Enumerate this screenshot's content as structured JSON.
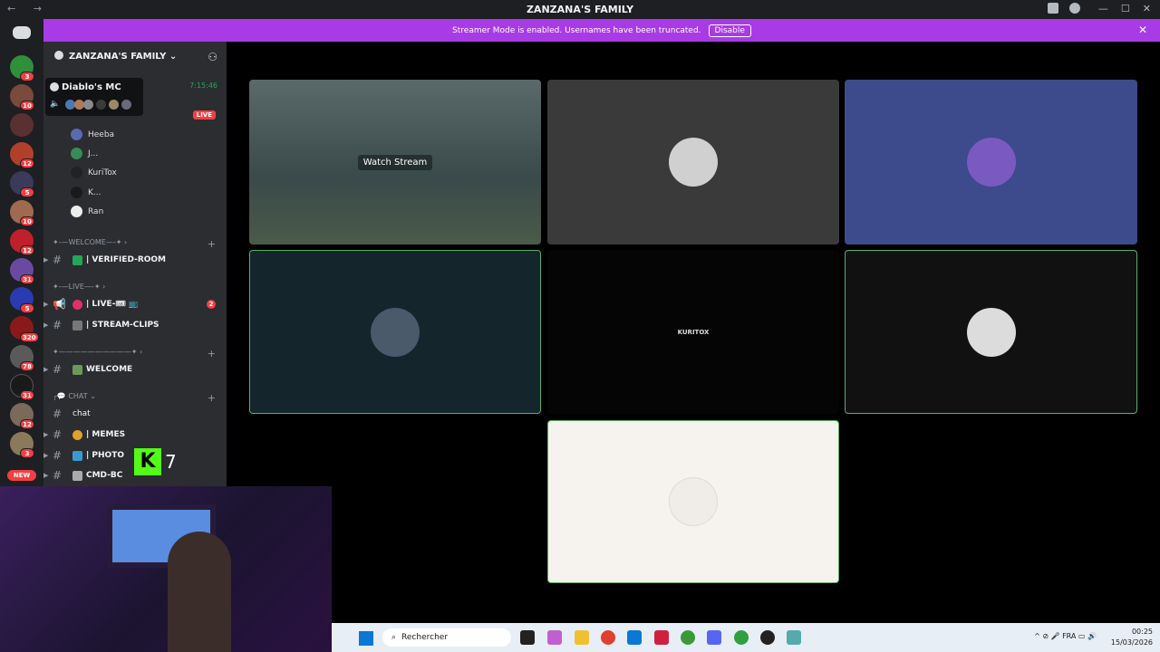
{
  "window": {
    "title": "ZANZANA'S FAMILY"
  },
  "banner": {
    "message": "Streamer Mode is enabled. Usernames have been truncated.",
    "button": "Disable"
  },
  "rail": {
    "badges": [
      "3",
      "10",
      "12",
      "5",
      "10",
      "12",
      "31",
      "5",
      "320",
      "78",
      "31",
      "12",
      "3"
    ],
    "new_label": "NEW"
  },
  "server": {
    "name": "ZANZANA'S FAMILY"
  },
  "voice": {
    "channel_name": "Diablo's MC",
    "elapsed": "7:15:46",
    "live_label": "LIVE",
    "users": [
      "Heeba",
      "J...",
      "KuriTox",
      "K...",
      "Ran"
    ]
  },
  "categories": {
    "welcome": "✦-—WELCOME—-✦",
    "live": "✦-—LIVE—-✦",
    "blank": "✦——————————✦",
    "chat": "╭💬 CHAT"
  },
  "channels": {
    "verified": "| VERIFIED-ROOM",
    "live": "| LIVE-🎟 📺",
    "live_count": "2",
    "clips": "| STREAM-CLIPS",
    "welcome": "WELCOME",
    "chat": "chat",
    "memes": "| MEMES",
    "photo": "| PHOTO",
    "cmd": "CMD-BC"
  },
  "overlay": {
    "k7_number": "7"
  },
  "stage": {
    "watch_label": "Watch Stream",
    "kuritox_logo": "KURITOX"
  },
  "taskbar": {
    "search_placeholder": "Rechercher",
    "lang": "FRA",
    "time": "00:25",
    "date": "15/03/2026"
  },
  "colors": {
    "banner": "#a83be6",
    "speaking": "#23a55a",
    "live": "#f23f43"
  }
}
